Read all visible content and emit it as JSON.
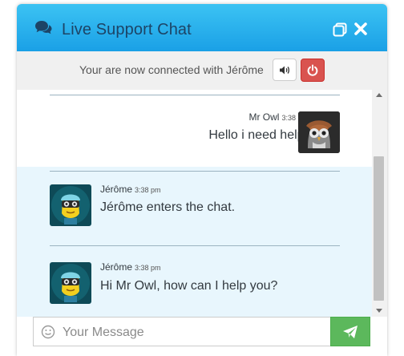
{
  "header": {
    "title": "Live Support Chat"
  },
  "statusbar": {
    "text": "Your are now connected with Jérôme"
  },
  "messages": [
    {
      "sender": "Mr Owl",
      "time": "3:38 pm",
      "text": "Hello i need help!",
      "role": "visitor"
    },
    {
      "sender": "Jérôme",
      "time": "3:38 pm",
      "text": "Jérôme enters the chat.",
      "role": "agent"
    },
    {
      "sender": "Jérôme",
      "time": "3:38 pm",
      "text": "Hi Mr Owl, how can I help you?",
      "role": "agent"
    }
  ],
  "composer": {
    "placeholder": "Your Message"
  },
  "colors": {
    "header_gradient_top": "#3cc3f3",
    "header_gradient_bottom": "#1aa0e6",
    "agent_message_bg": "#e8f6fd",
    "power_button": "#d9534f",
    "send_button": "#5cb85c"
  },
  "icons": {
    "header": [
      "comments-icon",
      "restore-window-icon",
      "close-icon"
    ],
    "statusbar": [
      "volume-icon",
      "power-icon"
    ],
    "composer": [
      "smile-icon",
      "paper-plane-icon"
    ]
  }
}
